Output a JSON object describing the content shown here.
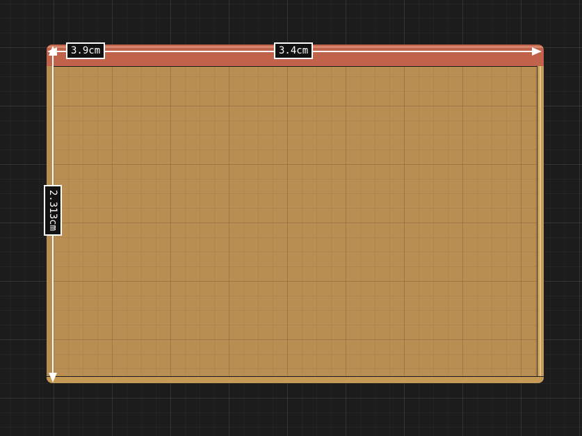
{
  "canvas": {
    "background_color": "#1c1c1c",
    "grid_color": "#2a2a2a"
  },
  "part": {
    "face_color": "#b88e52",
    "top_edge_color": "#c0634a",
    "edge_strip_color": "#c79b58"
  },
  "dimensions": {
    "top_left_label": "3.9cm",
    "width_label": "3.4cm",
    "height_label": "2.313cm",
    "line_color": "#ffffff"
  }
}
